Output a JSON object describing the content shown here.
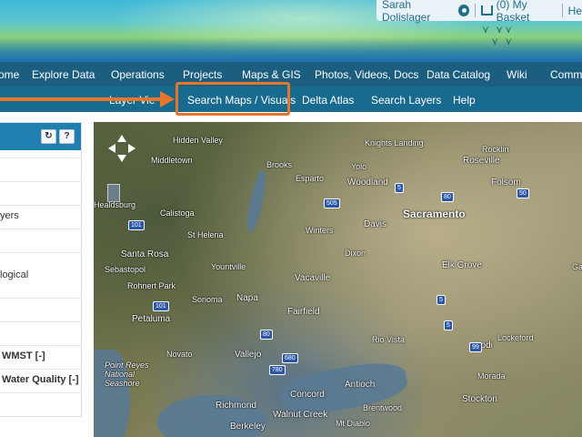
{
  "user": {
    "name": "Sarah Dolislager",
    "basket": "(0) My Basket",
    "help": "He"
  },
  "main_nav": [
    "ome",
    "Explore Data",
    "Operations",
    "Projects",
    "Maps & GIS",
    "Photos, Videos, Docs",
    "Data Catalog",
    "Wiki",
    "Commu"
  ],
  "sub_nav": [
    "Layer Vie",
    "Search Maps / Visuals",
    "Delta Atlas",
    "Search Layers",
    "Help"
  ],
  "panel": {
    "refresh_icon": "↻",
    "help_label": "?",
    "rows": [
      "yers",
      "logical",
      "WMST [-]",
      "Water Quality [-]"
    ]
  },
  "map": {
    "cities": [
      "Sacramento"
    ],
    "towns": [
      "Santa Rosa",
      "Davis",
      "Elk Grove",
      "Napa",
      "Vacaville",
      "Fairfield",
      "Vallejo",
      "Concord",
      "Antioch",
      "Lodi",
      "Stockton",
      "Petaluma",
      "Roseville",
      "Folsom",
      "Woodland",
      "Richmond",
      "Berkeley",
      "Walnut Creek"
    ],
    "small_towns": [
      "Hidden Valley",
      "Middletown",
      "Healdsburg",
      "Calistoga",
      "St Helena",
      "Sebastopol",
      "Rohnert Park",
      "Yountville",
      "Sonoma",
      "Novato",
      "Winters",
      "Dixon",
      "Esparto",
      "Brooks",
      "Knights Landing",
      "Yolo",
      "Rocklin",
      "Rio Vista",
      "Lockeford",
      "Brentwood",
      "Morada",
      "Galt"
    ],
    "features": [
      "Point Reyes National Seashore",
      "Mt Diablo"
    ],
    "highways": [
      "101",
      "80",
      "5",
      "505",
      "50",
      "780",
      "680",
      "99"
    ]
  }
}
